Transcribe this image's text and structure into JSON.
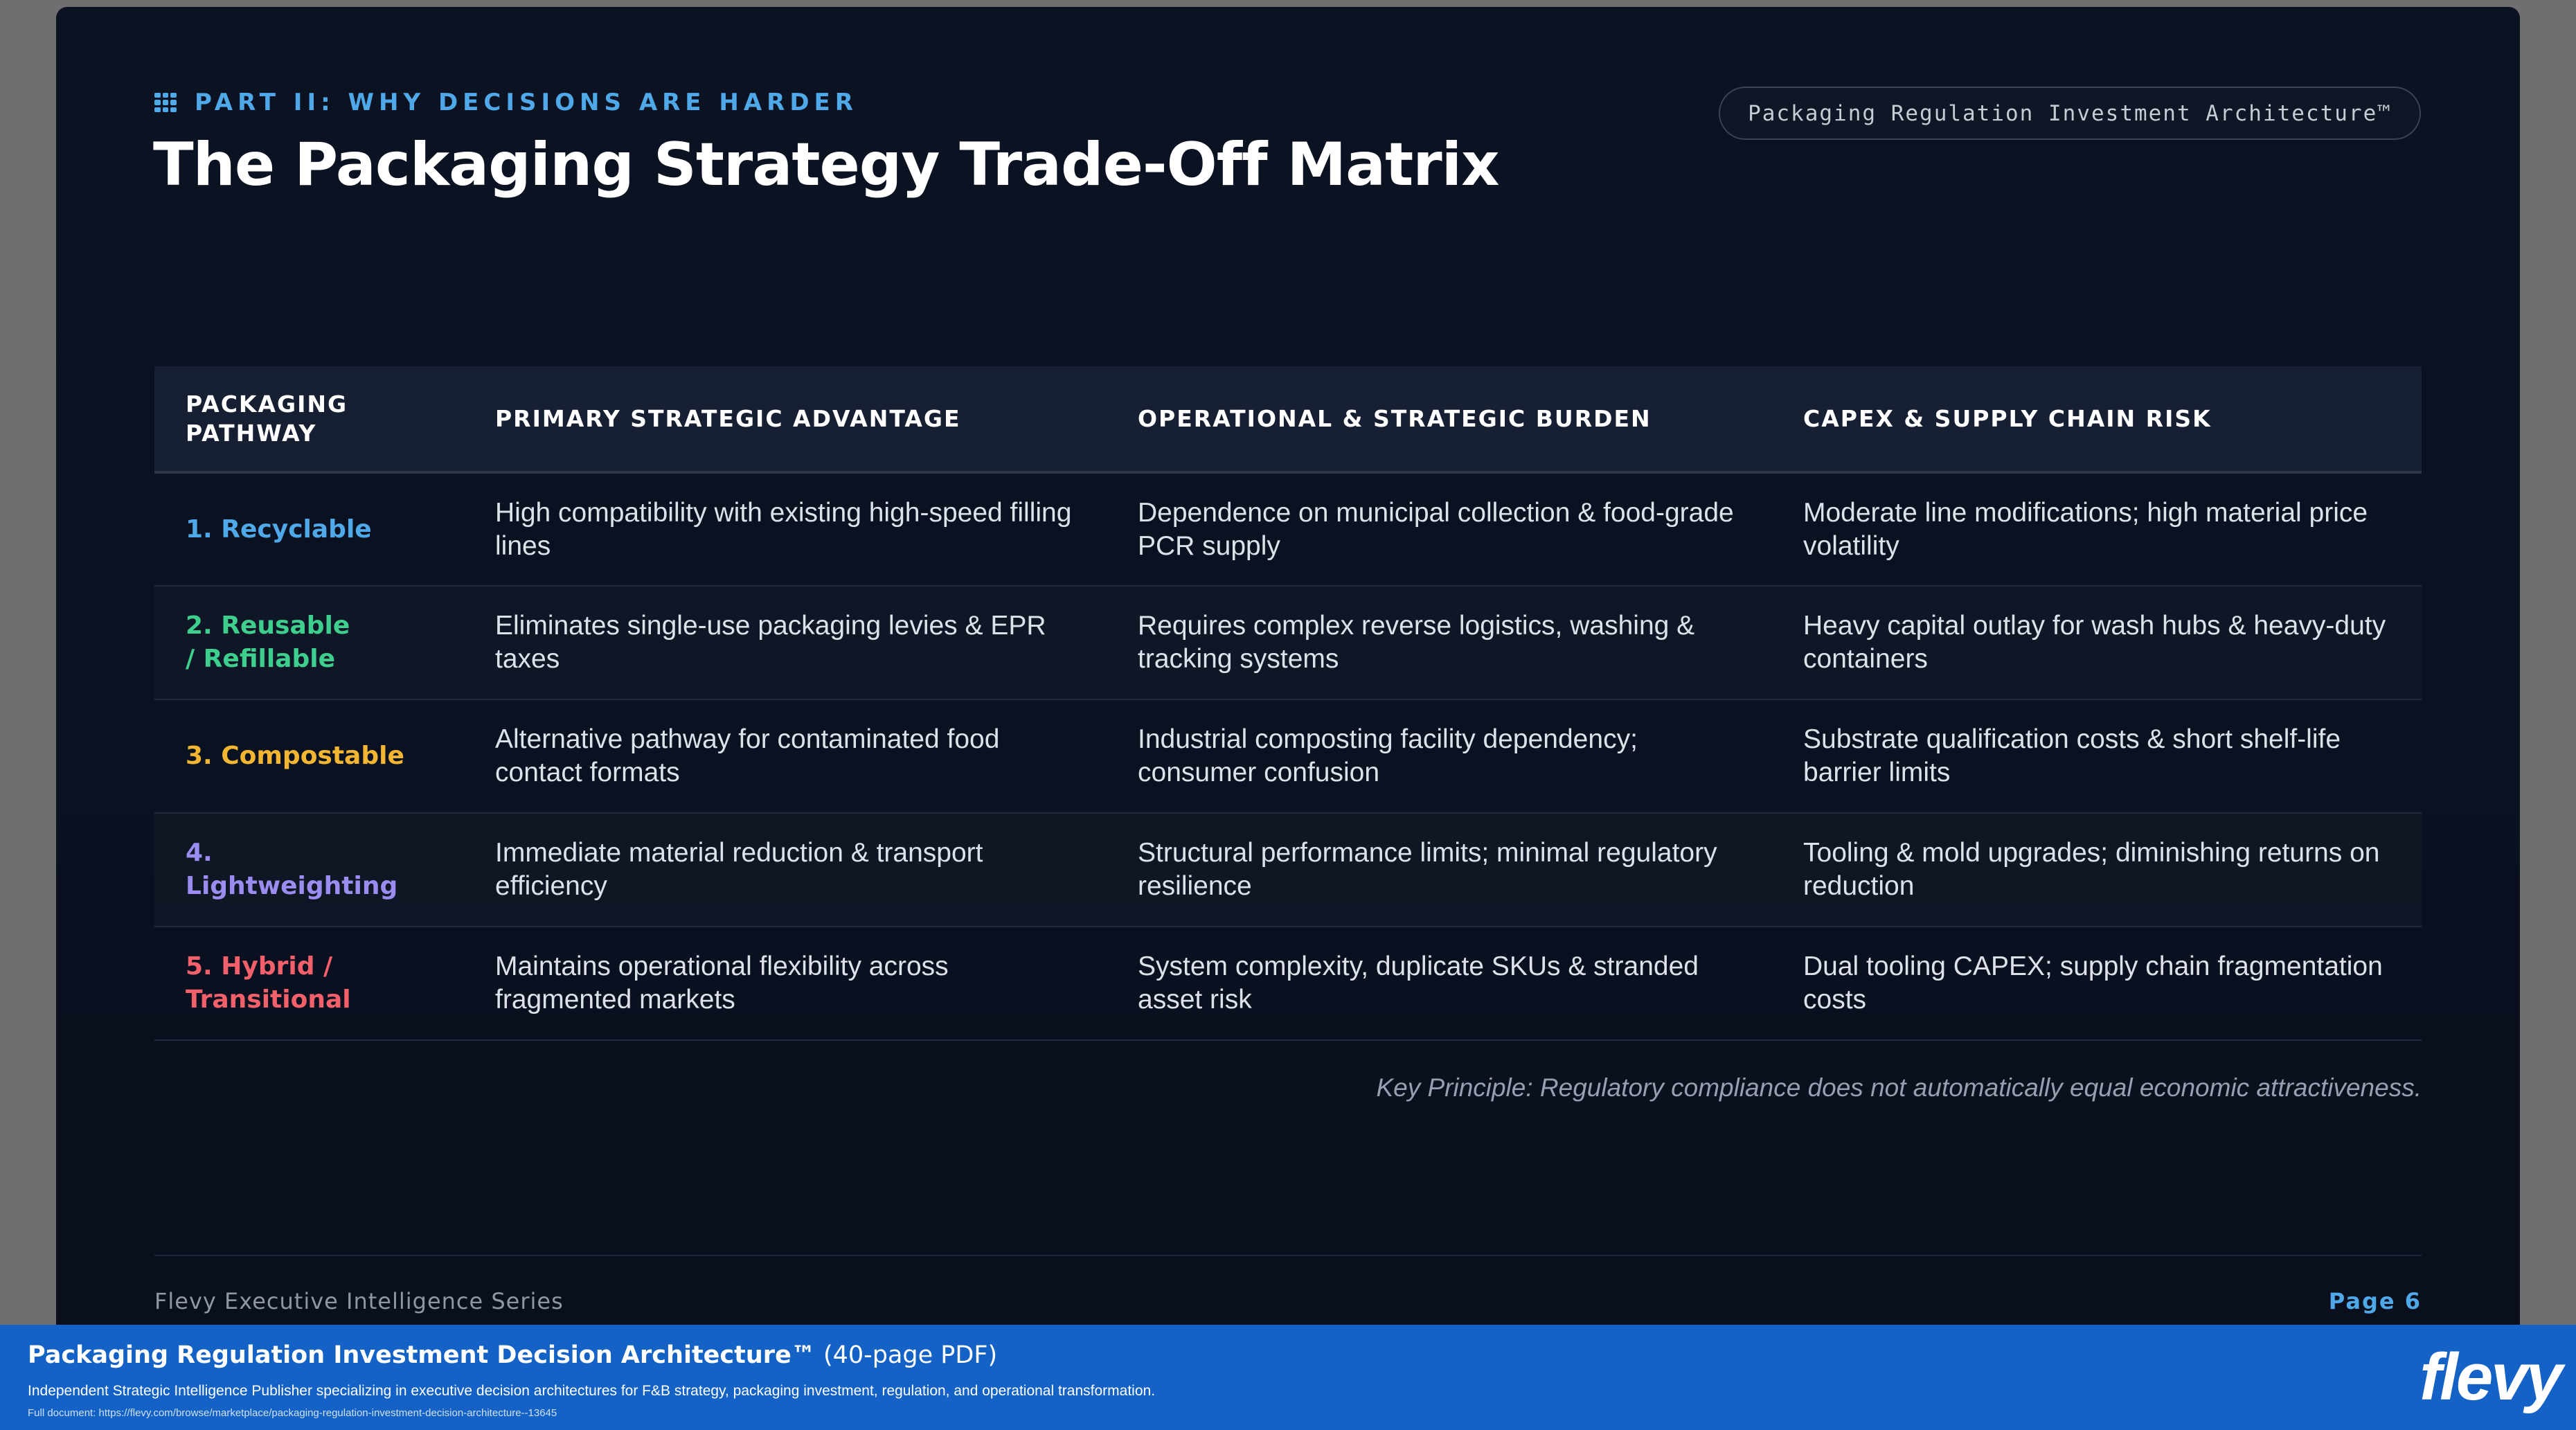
{
  "header": {
    "section_tag": "PART II: WHY DECISIONS ARE HARDER",
    "title": "The Packaging Strategy Trade-Off Matrix",
    "doc_label": "Packaging Regulation Investment Architecture™"
  },
  "table": {
    "columns": [
      "PACKAGING PATHWAY",
      "PRIMARY STRATEGIC ADVANTAGE",
      "OPERATIONAL & STRATEGIC BURDEN",
      "CAPEX & SUPPLY CHAIN RISK"
    ],
    "rows": [
      {
        "pathway": "1. Recyclable",
        "color": "#4fa8e8",
        "advantage": "High compatibility with existing high-speed filling lines",
        "burden": "Dependence on municipal collection & food-grade PCR supply",
        "risk": "Moderate line modifications; high material price volatility"
      },
      {
        "pathway": "2. Reusable / Refillable",
        "color": "#3ecf8e",
        "advantage": "Eliminates single-use packaging levies & EPR taxes",
        "burden": "Requires complex reverse logistics, washing & tracking systems",
        "risk": "Heavy capital outlay for wash hubs & heavy-duty containers"
      },
      {
        "pathway": "3. Compostable",
        "color": "#f2b632",
        "advantage": "Alternative pathway for contaminated food contact formats",
        "burden": "Industrial composting facility dependency; consumer confusion",
        "risk": "Substrate qualification costs & short shelf-life barrier limits"
      },
      {
        "pathway": "4. Lightweighting",
        "color": "#9b8cf0",
        "advantage": "Immediate material reduction & transport efficiency",
        "burden": "Structural performance limits; minimal regulatory resilience",
        "risk": "Tooling & mold upgrades; diminishing returns on reduction"
      },
      {
        "pathway": "5. Hybrid / Transitional",
        "color": "#f2616b",
        "advantage": "Maintains operational flexibility across fragmented markets",
        "burden": "System complexity, duplicate SKUs & stranded asset risk",
        "risk": "Dual tooling CAPEX; supply chain fragmentation costs"
      }
    ]
  },
  "principle": "Key Principle: Regulatory compliance does not automatically equal economic attractiveness.",
  "footer": {
    "series": "Flevy Executive Intelligence Series",
    "page": "Page  6"
  },
  "banner": {
    "title": "Packaging Regulation Investment Decision Architecture™",
    "title_suffix": " (40-page PDF)",
    "description": "Independent Strategic Intelligence Publisher specializing in executive decision architectures for F&B strategy, packaging investment, regulation, and operational transformation.",
    "link": "Full document: https://flevy.com/browse/marketplace/packaging-regulation-investment-decision-architecture--13645",
    "brand": "flevy"
  }
}
